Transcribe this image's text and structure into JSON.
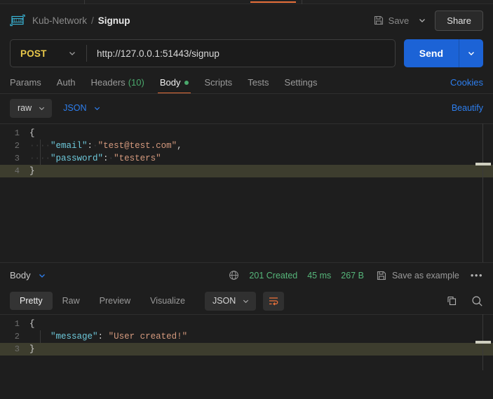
{
  "header": {
    "app_icon": "http-badge-icon",
    "breadcrumb_parent": "Kub-Network",
    "breadcrumb_separator": "/",
    "breadcrumb_current": "Signup",
    "save_label": "Save",
    "save_icon": "floppy-disk-icon",
    "save_caret_icon": "chevron-down-icon",
    "share_label": "Share"
  },
  "request": {
    "method": "POST",
    "method_caret_icon": "chevron-down-icon",
    "url": "http://127.0.0.1:51443/signup",
    "send_label": "Send",
    "send_caret_icon": "chevron-down-icon",
    "tabs": [
      {
        "label": "Params",
        "count": "",
        "active": false
      },
      {
        "label": "Auth",
        "count": "",
        "active": false
      },
      {
        "label": "Headers",
        "count": "(10)",
        "active": false
      },
      {
        "label": "Body",
        "count": "",
        "active": true
      },
      {
        "label": "Scripts",
        "count": "",
        "active": false
      },
      {
        "label": "Tests",
        "count": "",
        "active": false
      },
      {
        "label": "Settings",
        "count": "",
        "active": false
      }
    ],
    "cookies_label": "Cookies",
    "body_mode": "raw",
    "body_mode_caret_icon": "chevron-down-icon",
    "body_language": "JSON",
    "body_language_caret_icon": "chevron-down-icon",
    "beautify_label": "Beautify",
    "body_lines": [
      {
        "num": "1",
        "indent": "",
        "content_plain": "{",
        "highlight": false
      },
      {
        "num": "2",
        "indent": "····",
        "key": "\"email\"",
        "colon": ":",
        "space": "·",
        "value": "\"test@test.com\"",
        "tail": ",",
        "highlight": false
      },
      {
        "num": "3",
        "indent": "····",
        "key": "\"password\"",
        "colon": ":",
        "space": "·",
        "value": "\"testers\"",
        "tail": "",
        "highlight": false
      },
      {
        "num": "4",
        "indent": "",
        "content_plain": "}",
        "highlight": true
      }
    ]
  },
  "response": {
    "body_label": "Body",
    "body_caret_icon": "chevron-down-icon",
    "network_icon": "globe-icon",
    "status": "201 Created",
    "time": "45 ms",
    "size": "267 B",
    "save_example_label": "Save as example",
    "save_example_icon": "floppy-disk-icon",
    "more_label": "•••",
    "tabs": [
      {
        "label": "Pretty",
        "active": true
      },
      {
        "label": "Raw",
        "active": false
      },
      {
        "label": "Preview",
        "active": false
      },
      {
        "label": "Visualize",
        "active": false
      }
    ],
    "language": "JSON",
    "language_caret_icon": "chevron-down-icon",
    "wrap_icon": "word-wrap-icon",
    "copy_icon": "copy-icon",
    "search_icon": "search-icon",
    "body_lines": [
      {
        "num": "1",
        "indent": "",
        "content_plain": "{",
        "highlight": false
      },
      {
        "num": "2",
        "indent": "    ",
        "key": "\"message\"",
        "colon": ":",
        "space": " ",
        "value": "\"User created!\"",
        "tail": "",
        "highlight": false
      },
      {
        "num": "3",
        "indent": "",
        "content_plain": "}",
        "highlight": true
      }
    ]
  },
  "colors": {
    "accent_orange": "#e8703a",
    "send_blue": "#1c63d6",
    "link_blue": "#2d7ff0",
    "method_yellow": "#e8c84a",
    "status_green": "#56b67a",
    "json_key": "#6ec9db",
    "json_string": "#d59a7e"
  }
}
